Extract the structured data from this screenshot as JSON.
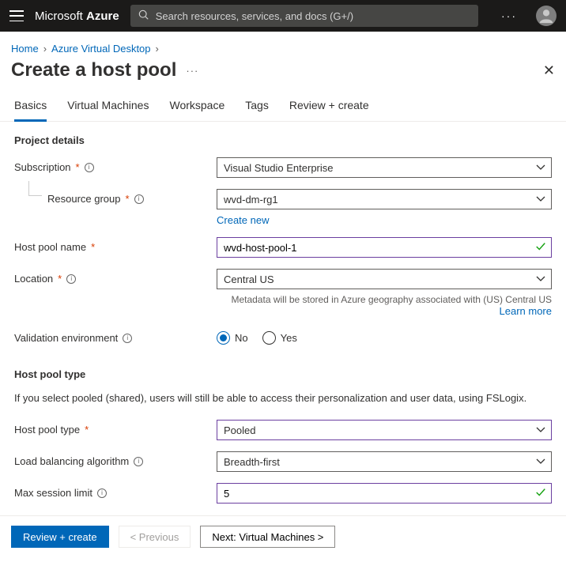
{
  "topbar": {
    "brand_prefix": "Microsoft ",
    "brand_bold": "Azure",
    "search_placeholder": "Search resources, services, and docs (G+/)"
  },
  "breadcrumb": {
    "home": "Home",
    "service": "Azure Virtual Desktop"
  },
  "page": {
    "title": "Create a host pool"
  },
  "tabs": [
    "Basics",
    "Virtual Machines",
    "Workspace",
    "Tags",
    "Review + create"
  ],
  "section_project_details": "Project details",
  "fields": {
    "subscription": {
      "label": "Subscription",
      "value": "Visual Studio Enterprise"
    },
    "resource_group": {
      "label": "Resource group",
      "value": "wvd-dm-rg1",
      "create_new": "Create new"
    },
    "host_pool_name": {
      "label": "Host pool name",
      "value": "wvd-host-pool-1"
    },
    "location": {
      "label": "Location",
      "value": "Central US",
      "helper": "Metadata will be stored in Azure geography associated with (US) Central US",
      "learn_more": "Learn more"
    },
    "validation_env": {
      "label": "Validation environment",
      "no": "No",
      "yes": "Yes",
      "selected": "No"
    }
  },
  "section_host_pool_type": "Host pool type",
  "host_pool_desc": "If you select pooled (shared), users will still be able to access their personalization and user data, using FSLogix.",
  "fields2": {
    "host_pool_type": {
      "label": "Host pool type",
      "value": "Pooled"
    },
    "load_balancing": {
      "label": "Load balancing algorithm",
      "value": "Breadth-first"
    },
    "max_session": {
      "label": "Max session limit",
      "value": "5"
    }
  },
  "footer": {
    "review": "Review + create",
    "previous": "< Previous",
    "next": "Next: Virtual Machines >"
  }
}
